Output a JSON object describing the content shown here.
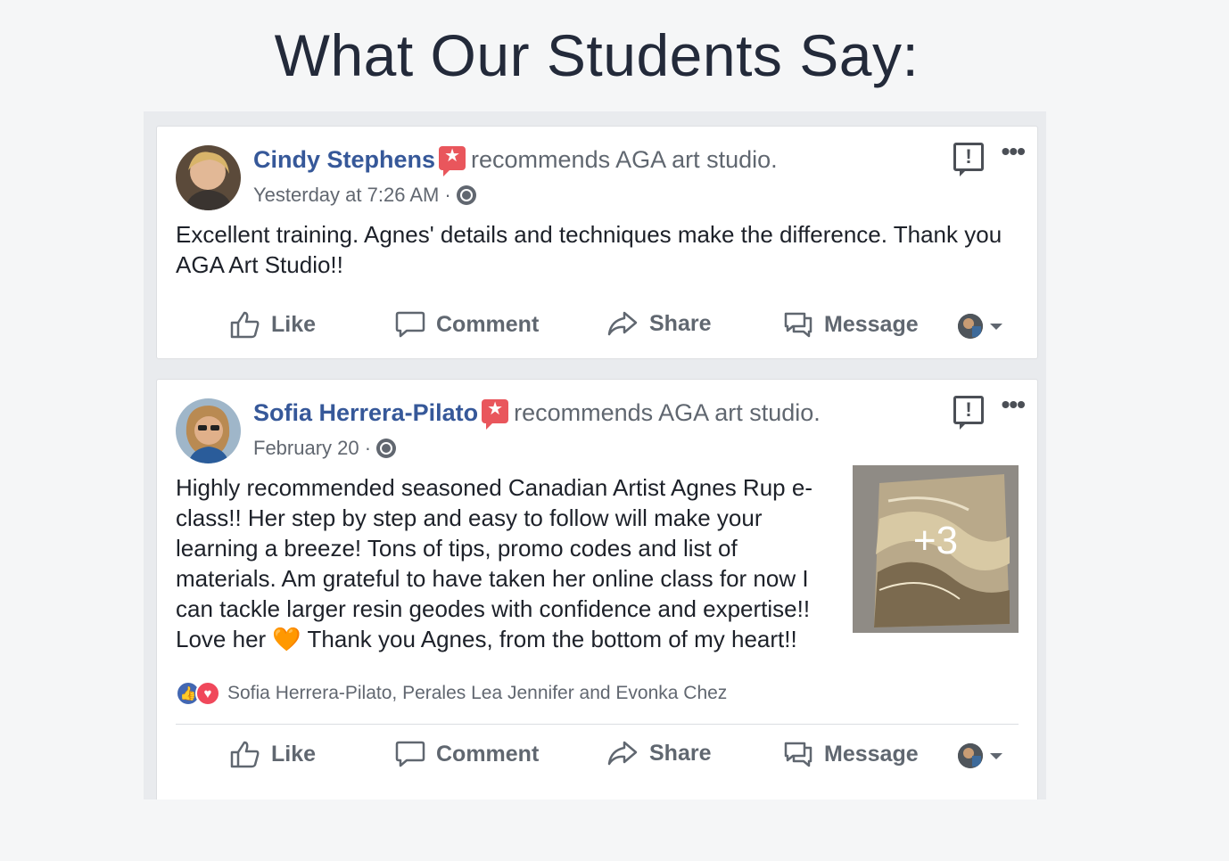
{
  "page": {
    "title": "What Our Students Say:"
  },
  "posts": [
    {
      "author": "Cindy Stephens",
      "recommends": "recommends AGA art studio.",
      "timestamp": "Yesterday at 7:26 AM ·",
      "text": "Excellent training. Agnes' details and techniques make the difference. Thank you AGA Art Studio!!",
      "actions": {
        "like": "Like",
        "comment": "Comment",
        "share": "Share",
        "message": "Message"
      }
    },
    {
      "author": "Sofia Herrera-Pilato",
      "recommends": "recommends AGA art studio.",
      "timestamp": "February 20 ·",
      "text": "Highly recommended seasoned Canadian Artist Agnes Rup e-class!! Her step by step and easy to follow will make your learning a breeze! Tons of tips, promo codes and list of materials. Am grateful to have taken her online class for now I can tackle larger resin geodes with confidence and expertise!! Love her 🧡 Thank you Agnes, from the bottom of my heart!!",
      "photo_more_count": "+3",
      "reactions_text": "Sofia Herrera-Pilato, Perales Lea Jennifer and Evonka Chez",
      "actions": {
        "like": "Like",
        "comment": "Comment",
        "share": "Share",
        "message": "Message"
      }
    }
  ],
  "colors": {
    "author_link": "#365899",
    "recommend_badge": "#e9565c",
    "title": "#232a3a",
    "like_reaction": "#4267b2",
    "love_reaction": "#f0485b"
  }
}
